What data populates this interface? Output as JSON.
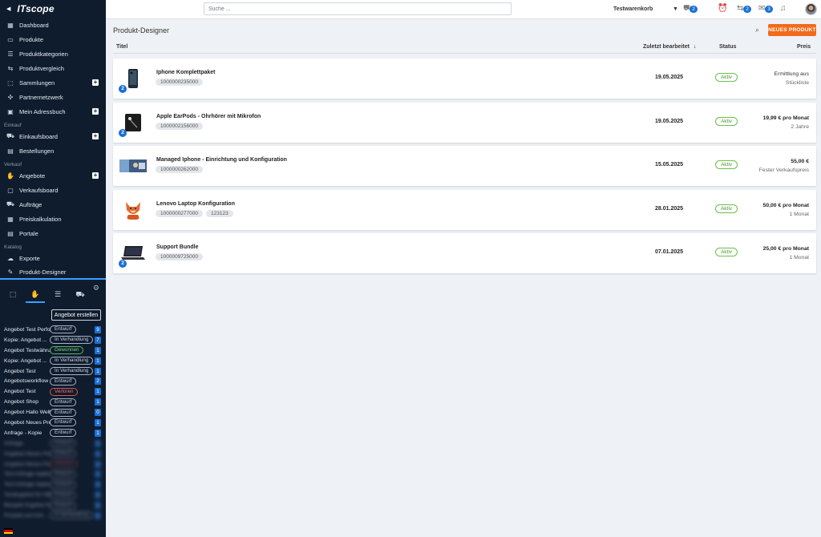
{
  "brand": {
    "logo": "ITscope"
  },
  "sidebar": {
    "main_items": [
      {
        "label": "Dashboard",
        "icon": "dashboard-icon",
        "glyph": "▦"
      },
      {
        "label": "Produkte",
        "icon": "monitor-icon",
        "glyph": "▭"
      },
      {
        "label": "Produktkategorien",
        "icon": "list-icon",
        "glyph": "☰"
      },
      {
        "label": "Produktvergleich",
        "icon": "compare-icon",
        "glyph": "⇆"
      },
      {
        "label": "Sammlungen",
        "icon": "box-icon",
        "glyph": "⬚",
        "plus": true
      },
      {
        "label": "Partnernetzwerk",
        "icon": "network-icon",
        "glyph": "✣"
      },
      {
        "label": "Mein Adressbuch",
        "icon": "addressbook-icon",
        "glyph": "▣",
        "plus": true
      }
    ],
    "section_einkauf": "Einkauf",
    "einkauf_items": [
      {
        "label": "Einkaufsboard",
        "icon": "cart-icon",
        "glyph": "⛟",
        "plus": true
      },
      {
        "label": "Bestellungen",
        "icon": "orders-icon",
        "glyph": "▤"
      }
    ],
    "section_verkauf": "Verkauf",
    "verkauf_items": [
      {
        "label": "Angebote",
        "icon": "handshake-icon",
        "glyph": "✋",
        "plus": true
      },
      {
        "label": "Verkaufsboard",
        "icon": "bag-icon",
        "glyph": "▢"
      },
      {
        "label": "Aufträge",
        "icon": "truck-icon",
        "glyph": "⛟"
      },
      {
        "label": "Preiskalkulation",
        "icon": "calculator-icon",
        "glyph": "▦"
      },
      {
        "label": "Portale",
        "icon": "portal-icon",
        "glyph": "▤"
      }
    ],
    "section_katalog": "Katalog",
    "katalog_items": [
      {
        "label": "Exporte",
        "icon": "cloud-icon",
        "glyph": "☁"
      },
      {
        "label": "Produkt-Designer",
        "icon": "designer-icon",
        "glyph": "✎",
        "active": true
      }
    ],
    "create_button": "Angebot erstellen",
    "angebote": [
      {
        "name": "Angebot Test Performa...",
        "status": "Entwurf",
        "count": "9",
        "color": "grey"
      },
      {
        "name": "Kopie: Angebot ...",
        "status": "In Verhandlung",
        "count": "7",
        "color": "grey"
      },
      {
        "name": "Angebot Testwährung",
        "status": "Gewonnen",
        "count": "1",
        "color": "green"
      },
      {
        "name": "Kopie: Angebot ...",
        "status": "In Verhandlung",
        "count": "1",
        "color": "grey"
      },
      {
        "name": "Angebot Test",
        "status": "In Verhandlung",
        "count": "1",
        "color": "grey"
      },
      {
        "name": "Angebotsworkflow",
        "status": "Entwurf",
        "count": "2",
        "color": "grey"
      },
      {
        "name": "Angebot Test",
        "status": "Verloren",
        "count": "1",
        "color": "red"
      },
      {
        "name": "Angebot Shop",
        "status": "Entwurf",
        "count": "1",
        "color": "grey"
      },
      {
        "name": "Angebot Hallo Welt",
        "status": "Entwurf",
        "count": "0",
        "color": "grey"
      },
      {
        "name": "Angebot Neues Produkt...",
        "status": "Entwurf",
        "count": "1",
        "color": "grey"
      },
      {
        "name": "Anfrage - Kopie",
        "status": "Entwurf",
        "count": "1",
        "color": "grey"
      }
    ],
    "blurred_angebote": [
      {
        "name": "Anfrage",
        "status": "Entwurf",
        "count": "1",
        "color": "grey"
      },
      {
        "name": "Angebot Neues Produkt...",
        "status": "Entwurf",
        "count": "1",
        "color": "grey"
      },
      {
        "name": "Angebot Neues Produkt",
        "status": "Verloren",
        "count": "1",
        "color": "red"
      },
      {
        "name": "Test Anfrage Apple - Ru...",
        "status": "Entwurf",
        "count": "1",
        "color": "grey"
      },
      {
        "name": "Test Anfrage Apple",
        "status": "Entwurf",
        "count": "1",
        "color": "grey"
      },
      {
        "name": "Testangebot für Office",
        "status": "Entwurf",
        "count": "1",
        "color": "grey"
      },
      {
        "name": "Beispiel Angebot für Offi...",
        "status": "Entwurf",
        "count": "1",
        "color": "grey"
      },
      {
        "name": "Produkt auf Anfr...",
        "status": "In Verhandlung",
        "count": "1",
        "color": "grey"
      }
    ]
  },
  "topbar": {
    "search_placeholder": "Suche ...",
    "cart_label": "Testwarenkorb",
    "cart_count": "2",
    "transfer_count": "2",
    "notify_count": "3"
  },
  "main": {
    "title": "Produkt-Designer",
    "new_button": "NEUES PRODUKT",
    "columns": {
      "title": "Titel",
      "edited": "Zuletzt bearbeitet",
      "status": "Status",
      "price": "Preis"
    },
    "products": [
      {
        "title": "Iphone Komplettpaket",
        "skus": [
          "1000000235000"
        ],
        "date": "19.05.2025",
        "status": "Aktiv",
        "price_main": "Ermittlung aus",
        "price_sub": "Stückliste",
        "badge": "2",
        "plain": true,
        "thumb": "phone"
      },
      {
        "title": "Apple EarPods - Ohrhörer mit Mikrofon",
        "skus": [
          "1000002156000"
        ],
        "date": "19.05.2025",
        "status": "Aktiv",
        "price_main": "19,99 € pro Monat",
        "price_sub": "2 Jahre",
        "badge": "2",
        "plain": false,
        "thumb": "earpods"
      },
      {
        "title": "Managed Iphone - Einrichtung und Konfiguration",
        "skus": [
          "1000000262000"
        ],
        "date": "15.05.2025",
        "status": "Aktiv",
        "price_main": "55,00 €",
        "price_sub": "Fester Verkaufspreis",
        "badge": "",
        "plain": false,
        "thumb": "banner"
      },
      {
        "title": "Lenovo Laptop Konfiguration",
        "skus": [
          "1000000277000",
          "123123"
        ],
        "date": "28.01.2025",
        "status": "Aktiv",
        "price_main": "50,00 € pro Monat",
        "price_sub": "1 Monat",
        "badge": "",
        "plain": false,
        "thumb": "fox"
      },
      {
        "title": "Support Bundle",
        "skus": [
          "1000009725000"
        ],
        "date": "07.01.2025",
        "status": "Aktiv",
        "price_main": "25,00 € pro Monat",
        "price_sub": "1 Monat",
        "badge": "2",
        "plain": false,
        "thumb": "laptop"
      }
    ]
  },
  "colors": {
    "sidebar_bg": "#0f1c2e",
    "accent_orange": "#f26a1b",
    "accent_blue": "#1a6fd6",
    "status_green": "#6cbf4a"
  }
}
